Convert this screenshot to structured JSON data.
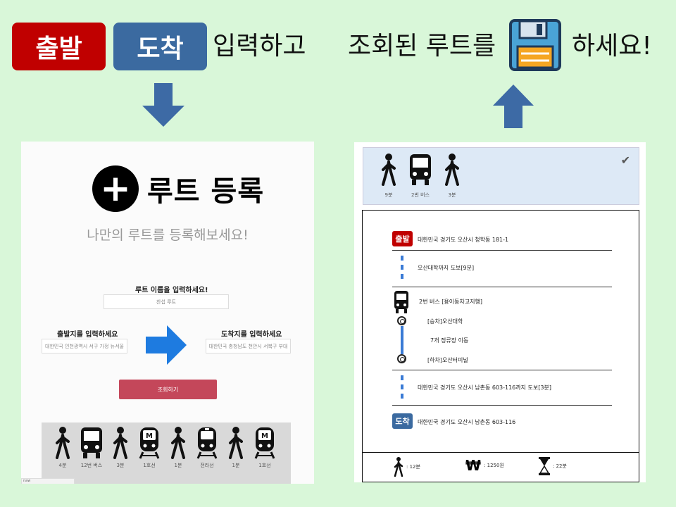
{
  "banner": {
    "start_badge": "출발",
    "end_badge": "도착",
    "text1": "입력하고",
    "text2": "조회된 루트를",
    "text3": "하세요!",
    "disk_icon": "save-disk-icon",
    "start_color": "#c00000",
    "end_color": "#3b6aa0",
    "arrow_color": "#3d6aa5"
  },
  "register": {
    "title": "루트 등록",
    "subtitle": "나만의 루트를 등록해보세요!",
    "name_label": "루트 이름을 입력하세요!",
    "name_value": "찬섭 루트",
    "start_label": "출발지를 입력하세요",
    "start_value": "대한민국 인천광역시 서구 가정 뉴서울",
    "end_label": "도착지를 입력하세요",
    "end_value": "대한민국 충청남도 천안시 서북구 부대",
    "search_button": "조회하기",
    "button_color": "#c4475a",
    "strip": [
      {
        "icon": "walk-icon",
        "label": "4분"
      },
      {
        "icon": "bus-icon",
        "label": "12번 버스"
      },
      {
        "icon": "walk-icon",
        "label": "3분"
      },
      {
        "icon": "metro-icon",
        "label": "1호선"
      },
      {
        "icon": "walk-icon",
        "label": "1분"
      },
      {
        "icon": "train-icon",
        "label": "전라선"
      },
      {
        "icon": "walk-icon",
        "label": "1분"
      },
      {
        "icon": "metro-icon",
        "label": "1호선"
      }
    ],
    "tiny_tab": "naw"
  },
  "result": {
    "summary": [
      {
        "icon": "walk-icon",
        "label": "9분"
      },
      {
        "icon": "bus-icon",
        "label": "2번 버스"
      },
      {
        "icon": "walk-icon",
        "label": "3분"
      }
    ],
    "check_icon": "checkmark-icon",
    "start_badge": "출발",
    "start_address": "대한민국 경기도 오산시 청학동 181-1",
    "walk1": "오산대학까지 도보[9분]",
    "bus_name": "2번 버스 [용이동차고지행]",
    "board": "[승차]오산대학",
    "stops": "7개 정류장 이동",
    "alight": "[하차]오산터미널",
    "walk2": "대한민국 경기도 오산시 남촌동 603-116까지 도보[3분]",
    "end_badge": "도착",
    "end_address": "대한민국 경기도 오산시 남촌동 603-116",
    "footer": {
      "walk": ": 12분",
      "fare": ": 1250원",
      "time": ": 22분"
    },
    "line_color": "#3a7bd5"
  }
}
